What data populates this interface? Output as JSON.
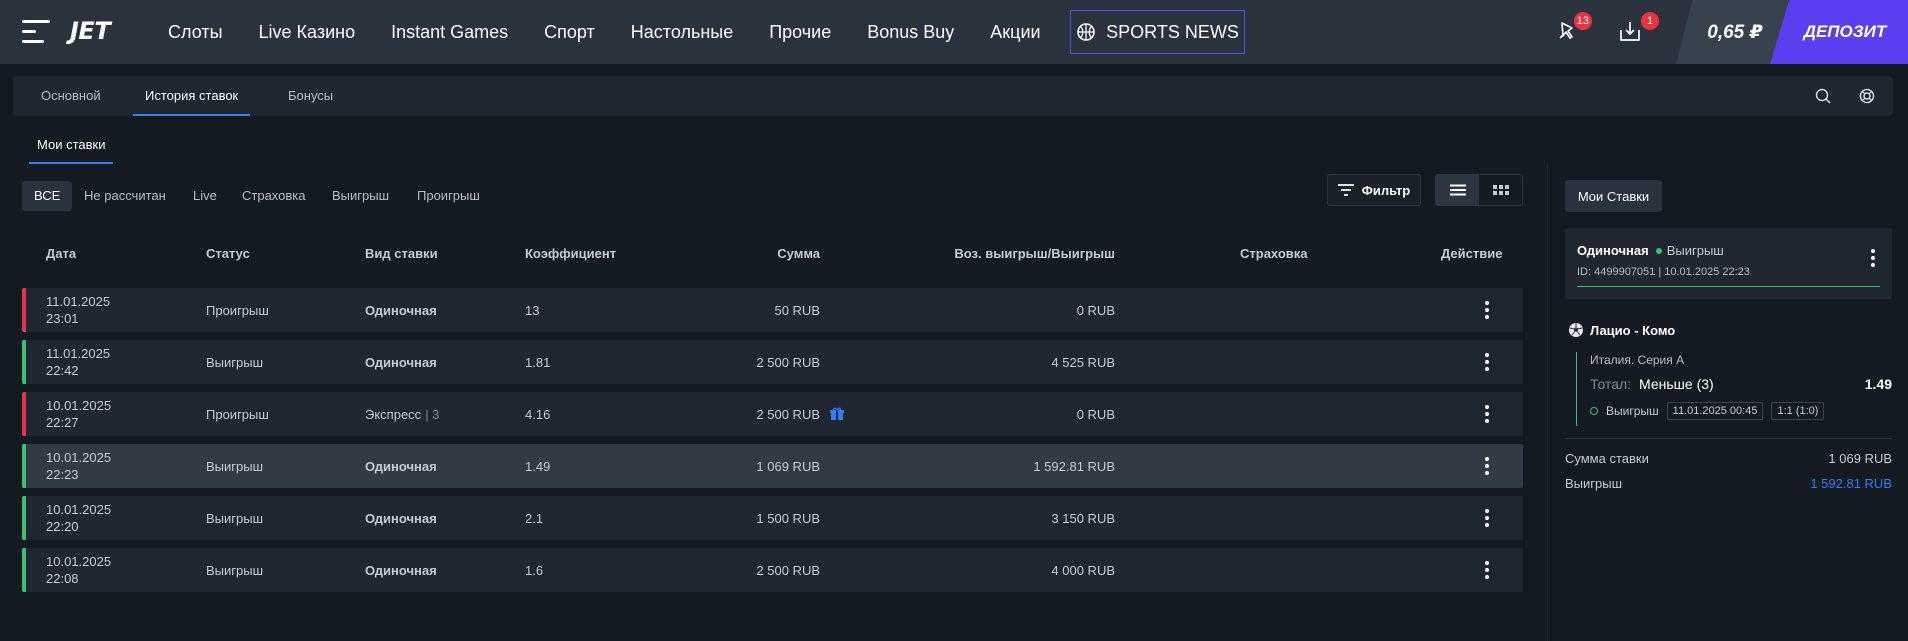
{
  "header": {
    "logo": "JET",
    "nav": [
      "Слоты",
      "Live Казино",
      "Instant Games",
      "Спорт",
      "Настольные",
      "Прочие",
      "Bonus Buy",
      "Акции"
    ],
    "sports_news": "SPORTS NEWS",
    "notifications_badge": "13",
    "inbox_badge": "1",
    "balance": "0,65 ₽",
    "deposit": "ДЕПОЗИТ"
  },
  "tabs": [
    "Основной",
    "История ставок",
    "Бонусы"
  ],
  "subtab": "Мои ставки",
  "filters": [
    "ВСЕ",
    "Не рассчитан",
    "Live",
    "Страховка",
    "Выигрыш",
    "Проигрыш"
  ],
  "filter_button": "Фильтр",
  "table": {
    "headers": [
      "Дата",
      "Статус",
      "Вид ставки",
      "Коэффициент",
      "Сумма",
      "Воз. выигрыш/Выигрыш",
      "Страховка",
      "Действие"
    ],
    "rows": [
      {
        "date": "11.01.2025",
        "time": "23:01",
        "status": "Проигрыш",
        "type": "Одиночная",
        "count": "",
        "coef": "13",
        "sum": "50 RUB",
        "payout": "0 RUB",
        "result_color": "#e8334f"
      },
      {
        "date": "11.01.2025",
        "time": "22:42",
        "status": "Выигрыш",
        "type": "Одиночная",
        "count": "",
        "coef": "1.81",
        "sum": "2 500 RUB",
        "payout": "4 525 RUB",
        "result_color": "#3fbf6e"
      },
      {
        "date": "10.01.2025",
        "time": "22:27",
        "status": "Проигрыш",
        "type": "Экспресс",
        "count": "| 3",
        "coef": "4.16",
        "sum": "2 500 RUB",
        "payout": "0 RUB",
        "result_color": "#e8334f"
      },
      {
        "date": "10.01.2025",
        "time": "22:23",
        "status": "Выигрыш",
        "type": "Одиночная",
        "count": "",
        "coef": "1.49",
        "sum": "1 069 RUB",
        "payout": "1 592.81 RUB",
        "result_color": "#3fbf6e"
      },
      {
        "date": "10.01.2025",
        "time": "22:20",
        "status": "Выигрыш",
        "type": "Одиночная",
        "count": "",
        "coef": "2.1",
        "sum": "1 500 RUB",
        "payout": "3 150 RUB",
        "result_color": "#3fbf6e"
      },
      {
        "date": "10.01.2025",
        "time": "22:08",
        "status": "Выигрыш",
        "type": "Одиночная",
        "count": "",
        "coef": "1.6",
        "sum": "2 500 RUB",
        "payout": "4 000 RUB",
        "result_color": "#3fbf6e"
      }
    ]
  },
  "panel": {
    "button": "Мои Ставки",
    "card_type": "Одиночная",
    "card_status": "Выигрыш",
    "card_meta": "ID: 4499907051  |  10.01.2025 22:23",
    "match": "Лацио - Комо",
    "league": "Италия. Серия А",
    "market_label": "Тотал:",
    "market_value": "Меньше (3)",
    "odds": "1.49",
    "result": "Выигрыш",
    "event_time": "11.01.2025 00:45",
    "score": "1:1 (1:0)",
    "stake_label": "Сумма ставки",
    "stake_value": "1 069 RUB",
    "win_label": "Выигрыш",
    "win_value": "1 592.81 RUB"
  }
}
